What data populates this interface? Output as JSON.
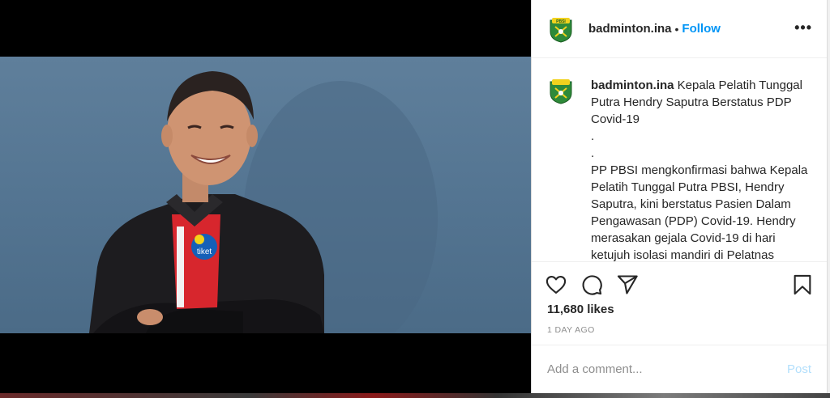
{
  "post": {
    "username": "badminton.ina",
    "follow_label": "Follow",
    "separator": "•",
    "more_label": "•••",
    "caption_title": "Kepala Pelatih Tunggal Putra Hendry Saputra Berstatus PDP Covid-19",
    "caption_body": ".\n.\nPP PBSI mengkonfirmasi bahwa Kepala Pelatih Tunggal Putra PBSI, Hendry Saputra, kini berstatus Pasien Dalam Pengawasan (PDP) Covid-19. Hendry merasakan gejala Covid-19 di hari ketujuh isolasi mandiri di Pelatnas",
    "likes": "11,680 likes",
    "time_ago": "1 DAY AGO",
    "comment_placeholder": "Add a comment...",
    "post_label": "Post",
    "shirt_logo_text": "tiket",
    "avatar_text": "PBSI"
  },
  "icons": {
    "like": "heart-icon",
    "comment": "comment-icon",
    "share": "share-icon",
    "save": "bookmark-icon",
    "more": "more-icon"
  },
  "colors": {
    "link": "#0095f6",
    "post_disabled": "#b2dffc",
    "text": "#262626",
    "muted": "#8e8e8e",
    "photo_bg": "#547592"
  }
}
